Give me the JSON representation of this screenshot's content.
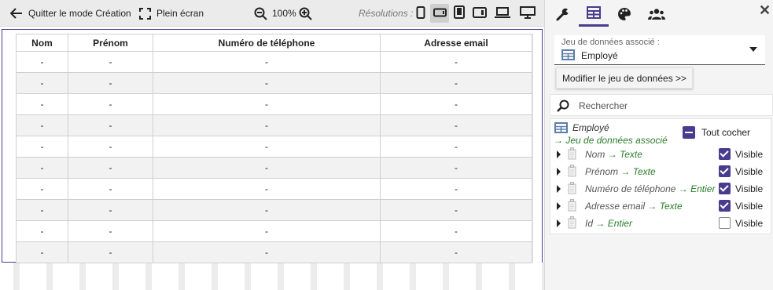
{
  "toolbar": {
    "quit_label": "Quitter le mode Création",
    "fullscreen_label": "Plein écran",
    "zoom_value": "100%",
    "resolutions_label": "Résolutions :",
    "active_resolution": "landscape-phone"
  },
  "table": {
    "headers": [
      "Nom",
      "Prénom",
      "Numéro de téléphone",
      "Adresse email"
    ],
    "placeholder": "-",
    "rows": [
      [
        "-",
        "-",
        "-",
        "-"
      ],
      [
        "-",
        "-",
        "-",
        "-"
      ],
      [
        "-",
        "-",
        "-",
        "-"
      ],
      [
        "-",
        "-",
        "-",
        "-"
      ],
      [
        "-",
        "-",
        "-",
        "-"
      ],
      [
        "-",
        "-",
        "-",
        "-"
      ],
      [
        "-",
        "-",
        "-",
        "-"
      ],
      [
        "-",
        "-",
        "-",
        "-"
      ],
      [
        "-",
        "-",
        "-",
        "-"
      ],
      [
        "-",
        "-",
        "-",
        "-"
      ]
    ]
  },
  "panel": {
    "tabs": [
      "settings-wrench",
      "table-grid",
      "palette",
      "user-group"
    ],
    "active_tab": "table-grid",
    "dataset": {
      "label": "Jeu de données associé :",
      "value": "Employé"
    },
    "modify_button": "Modifier le jeu de données >>",
    "search_placeholder": "Rechercher",
    "entity_name": "Employé",
    "entity_subtitle": "→ Jeu de données associé",
    "check_all_label": "Tout cocher",
    "fields": [
      {
        "name": "Nom",
        "type": "→ Texte",
        "visible": true,
        "visible_label": "Visible"
      },
      {
        "name": "Prénom",
        "type": "→ Texte",
        "visible": true,
        "visible_label": "Visible"
      },
      {
        "name": "Numéro de téléphone",
        "type": "→ Entier",
        "visible": true,
        "visible_label": "Visible"
      },
      {
        "name": "Adresse email",
        "type": "→ Texte",
        "visible": true,
        "visible_label": "Visible"
      },
      {
        "name": "Id",
        "type": "→ Entier",
        "visible": false,
        "visible_label": "Visible"
      }
    ]
  },
  "colors": {
    "accent": "#4a3b8f",
    "type_text": "#2a7d2a",
    "toolbar_bg": "#ebebeb",
    "panel_bg": "#f4f4f4"
  }
}
